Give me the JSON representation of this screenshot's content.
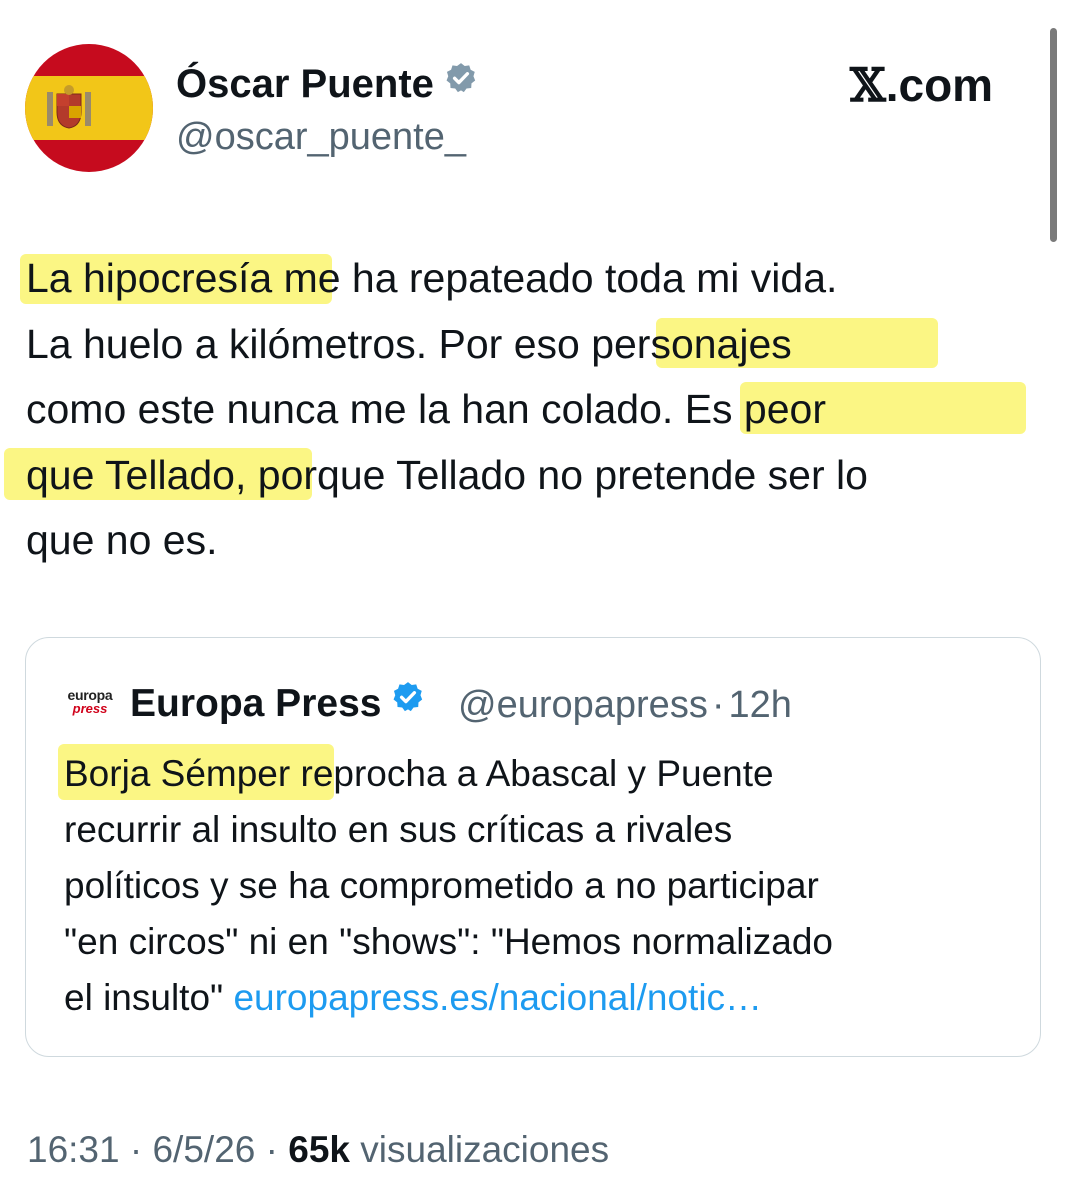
{
  "author": {
    "name": "Óscar Puente",
    "handle": "@oscar_puente_",
    "avatar_icon": "spanish-flag-icon",
    "verified_icon": "verified-badge-icon"
  },
  "brand": {
    "x_glyph": "𝕏",
    "suffix": ".com"
  },
  "tweet": {
    "lines": [
      [
        "La hipocresía",
        " me ha repateado toda mi vida."
      ],
      [
        "La huelo a kilómetros. Por es",
        "o personajes"
      ],
      [
        "como este nunca me la han colad",
        "o. Es peor"
      ],
      [
        "que Tellado,",
        " porque Tellado no pretende ser lo"
      ],
      [
        "que no es."
      ]
    ]
  },
  "quote": {
    "logo_top": "europa",
    "logo_bottom": "press",
    "name": "Europa Press",
    "handle": "@europapress",
    "separator": "·",
    "time": "12h",
    "lines": [
      [
        "Borja Sémper",
        " reprocha a Abascal y Puente"
      ],
      [
        "recurrir al insulto en sus críticas a rivales"
      ],
      [
        "políticos y se ha comprometido a no participar"
      ],
      [
        "\"en circos\" ni en \"shows\": \"Hemos normalizado"
      ],
      [
        "el insulto\" ",
        "europapress.es/nacional/notic…"
      ]
    ]
  },
  "meta": {
    "time": "16:31",
    "date": "6/5/26",
    "sep": "·",
    "views": "65k",
    "views_label": "visualizaciones"
  },
  "colors": {
    "highlight": "#fbf684",
    "link": "#1d9bf0",
    "secondary_text": "#536471",
    "verified": "#829aab"
  }
}
